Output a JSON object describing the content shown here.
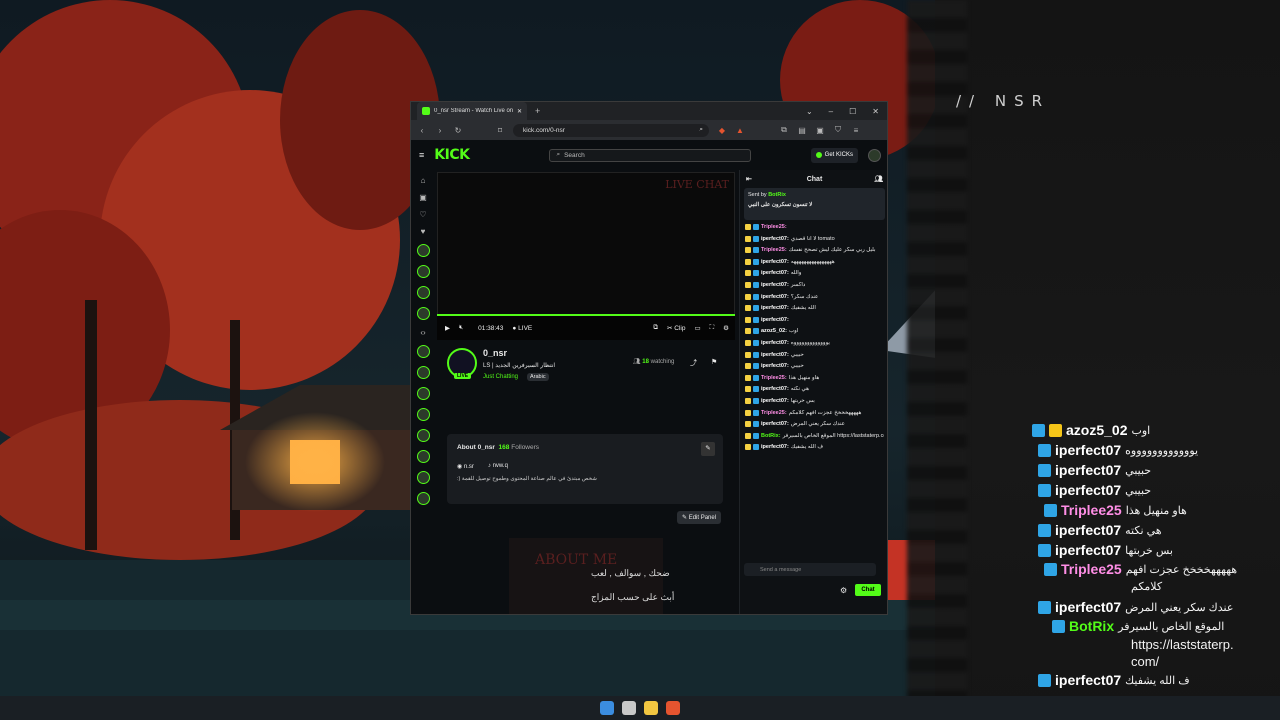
{
  "overlay_logo": "// NSR",
  "browser": {
    "tab_title": "0_nsr Stream - Watch Live on Ki",
    "url": "kick.com/0-nsr"
  },
  "kick": {
    "logo": "KICK",
    "search_placeholder": "Search",
    "get_kicks": "Get KICKs",
    "player": {
      "time": "01:38:43",
      "live": "LIVE",
      "clip": "Clip",
      "overlay_text": "LIVE CHAT"
    },
    "channel": {
      "name": "0_nsr",
      "title": "LS | انتظار السيرفرين الجديد",
      "category": "Just Chatting",
      "language": "Arabic",
      "watching_count": "18",
      "watching_label": "watching",
      "live_badge": "LIVE"
    },
    "about": {
      "heading": "About 0_nsr",
      "followers": "168",
      "followers_label": "Followers",
      "discord": "n.sr",
      "tiktok": "nvw.q",
      "bio": "شخص مبتدئ في عالم صناعة المحتوى وطموح توصيل للقمة (:",
      "edit_panel": "Edit Panel"
    },
    "panel": {
      "title": "ABOUT ME",
      "line1": "ضحك , سوالف , لعب",
      "line2": "أبث على حسب المزاج"
    },
    "chat": {
      "heading": "Chat",
      "pinned_by": "Sent by",
      "pinned_user": "BotRix",
      "pinned_text": "لا تنسون تسكرون على النبي",
      "send_placeholder": "Send a message",
      "send_label": "Chat",
      "messages": [
        {
          "user": "Triplee25",
          "text": "",
          "color": "pink"
        },
        {
          "user": "iperfect07",
          "text": "لا انا قصدي tomato",
          "color": "white"
        },
        {
          "user": "Triplee25",
          "text": "بليل ربي سكر عليك ليش تصحح نفسك",
          "color": "pink"
        },
        {
          "user": "iperfect07",
          "text": "ههههههههههههههههه",
          "color": "white"
        },
        {
          "user": "iperfect07",
          "text": "والله",
          "color": "white"
        },
        {
          "user": "iperfect07",
          "text": "داكسر",
          "color": "white"
        },
        {
          "user": "iperfect07",
          "text": "عندك سكر؟",
          "color": "white"
        },
        {
          "user": "iperfect07",
          "text": "الله يشفيك",
          "color": "white"
        },
        {
          "user": "iperfect07",
          "text": "",
          "color": "white"
        },
        {
          "user": "azoz5_02",
          "text": "اوب",
          "color": "white"
        },
        {
          "user": "iperfect07",
          "text": "يوووووووووووووه",
          "color": "white"
        },
        {
          "user": "iperfect07",
          "text": "حبيبي",
          "color": "white"
        },
        {
          "user": "iperfect07",
          "text": "حبيبي",
          "color": "white"
        },
        {
          "user": "Triplee25",
          "text": "هاو منهيل هذا",
          "color": "pink"
        },
        {
          "user": "iperfect07",
          "text": "هي نكته",
          "color": "white"
        },
        {
          "user": "iperfect07",
          "text": "بس خربتها",
          "color": "white"
        },
        {
          "user": "Triplee25",
          "text": "هههههخخخخ عجزت افهم كلامكم",
          "color": "pink"
        },
        {
          "user": "iperfect07",
          "text": "عندك سكر يعني المرض",
          "color": "white"
        },
        {
          "user": "BotRix",
          "text": "الموقع الخاص بالسيرفر https://laststaterp.com/",
          "color": "green"
        },
        {
          "user": "iperfect07",
          "text": "ف الله يشفيك",
          "color": "white"
        }
      ]
    }
  },
  "overlay_chat": [
    {
      "user": "azoz5_02",
      "text": "اوب",
      "color": "white",
      "crown": true
    },
    {
      "user": "iperfect07",
      "text": "يووووووووووووه",
      "color": "white",
      "crown": false
    },
    {
      "user": "iperfect07",
      "text": "حبيبي",
      "color": "white",
      "crown": false
    },
    {
      "user": "iperfect07",
      "text": "حبيبي",
      "color": "white",
      "crown": false
    },
    {
      "user": "Triplee25",
      "text": "هاو منهيل هذا",
      "color": "pink",
      "crown": false
    },
    {
      "user": "iperfect07",
      "text": "هي نكته",
      "color": "white",
      "crown": false
    },
    {
      "user": "iperfect07",
      "text": "بس خربتها",
      "color": "white",
      "crown": false
    },
    {
      "user": "Triplee25",
      "text": "هههههخخخخ عجزت افهم",
      "text2": "كلامكم",
      "color": "pink",
      "crown": false
    },
    {
      "user": "iperfect07",
      "text": "عندك سكر يعني المرض",
      "color": "white",
      "crown": false
    },
    {
      "user": "BotRix",
      "text": "الموقع الخاص بالسيرفر",
      "text2": "https://laststaterp.",
      "text3": "com/",
      "color": "green",
      "crown": false
    },
    {
      "user": "iperfect07",
      "text": "ف الله يشفيك",
      "color": "white",
      "crown": false
    }
  ],
  "colors": {
    "kick_green": "#53fc18",
    "pink_user": "#ff8ee6",
    "background": "#0d1418"
  }
}
